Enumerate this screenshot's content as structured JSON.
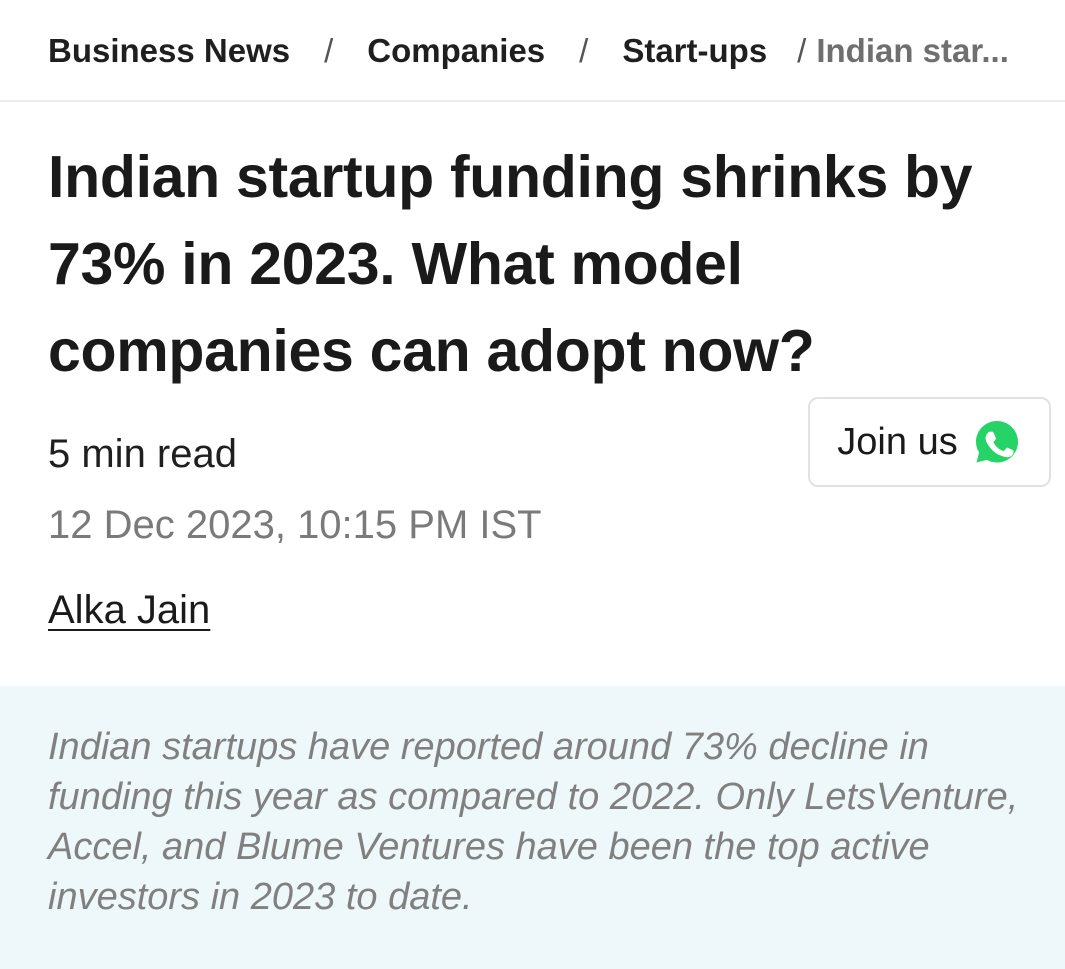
{
  "breadcrumb": {
    "items": [
      "Business News",
      "Companies",
      "Start-ups"
    ],
    "separator": "/",
    "current": "Indian star..."
  },
  "article": {
    "headline": "Indian startup funding shrinks by 73% in 2023. What model companies can adopt now?",
    "read_time": "5 min read",
    "date": "12 Dec 2023, 10:15 PM IST",
    "author": "Alka Jain",
    "summary": "Indian startups have reported around 73% decline in funding this year as compared to 2022. Only LetsVenture, Accel, and Blume Ventures have been the top active investors in 2023 to date."
  },
  "join_button": {
    "label": "Join us",
    "icon": "whatsapp-icon"
  },
  "colors": {
    "whatsapp": "#25D366",
    "summary_bg": "#eef8fa",
    "muted_text": "#7a7a7a"
  }
}
